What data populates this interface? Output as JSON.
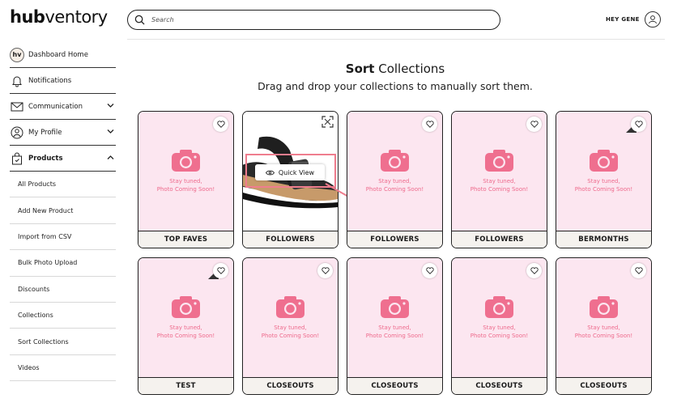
{
  "header": {
    "logo_bold": "hub",
    "logo_light": "ventory",
    "search_placeholder": "Search",
    "greeting": "HEY GENE"
  },
  "sidebar": {
    "items": [
      {
        "label": "Dashboard Home",
        "icon": "hv-badge"
      },
      {
        "label": "Notifications",
        "icon": "bell-icon"
      },
      {
        "label": "Communication",
        "icon": "envelope-icon",
        "chevron": "down"
      },
      {
        "label": "My Profile",
        "icon": "user-icon",
        "chevron": "down"
      },
      {
        "label": "Products",
        "icon": "shopping-bag-icon",
        "chevron": "up"
      }
    ],
    "subitems": [
      "All Products",
      "Add New Product",
      "Import from CSV",
      "Bulk Photo Upload",
      "Discounts",
      "Collections",
      "Sort Collections",
      "Videos"
    ]
  },
  "main": {
    "title_bold": "Sort",
    "title_light": " Collections",
    "subtitle": "Drag and drop your collections to manually sort them.",
    "placeholder_line1": "Stay tuned,",
    "placeholder_line2": "Photo Coming Soon!",
    "quick_view": "Quick View",
    "cards": [
      "TOP FAVES",
      "FOLLOWERS",
      "FOLLOWERS",
      "FOLLOWERS",
      "BERMONTHS",
      "TEST",
      "CLOSEOUTS",
      "CLOSEOUTS",
      "CLOSEOUTS",
      "CLOSEOUTS"
    ]
  },
  "colors": {
    "placeholder_bg": "#fce6f0",
    "placeholder_pink": "#ee6a8c",
    "label_bg": "#f5f2ee",
    "highlight": "#ef7d8e"
  }
}
